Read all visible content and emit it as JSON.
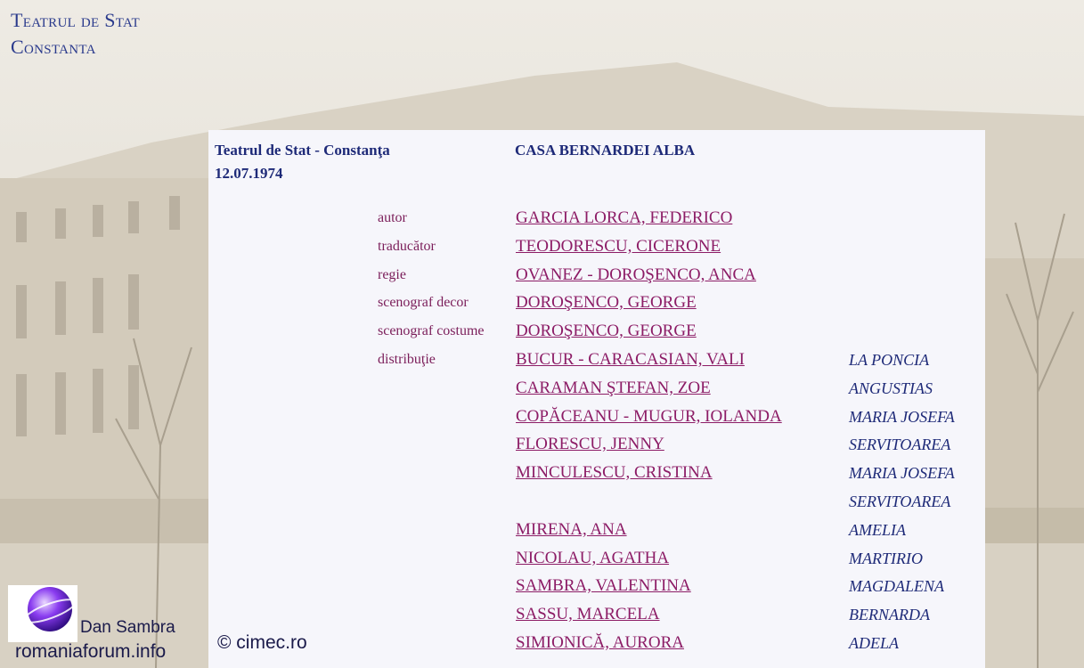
{
  "site_logo": {
    "line1": "Teatrul de Stat",
    "line2": "Constanta"
  },
  "header": {
    "theatre": "Teatrul de Stat - Constanţa",
    "date": "12.07.1974",
    "play_title": "CASA BERNARDEI ALBA"
  },
  "credits": [
    {
      "label": "autor",
      "name": "GARCIA LORCA, FEDERICO"
    },
    {
      "label": "traducător",
      "name": "TEODORESCU, CICERONE"
    },
    {
      "label": "regie",
      "name": "OVANEZ - DOROŞENCO, ANCA"
    },
    {
      "label": "scenograf decor",
      "name": "DOROŞENCO, GEORGE"
    },
    {
      "label": "scenograf costume",
      "name": "DOROŞENCO, GEORGE"
    }
  ],
  "cast_label": "distribuţie",
  "cast": [
    {
      "name": "BUCUR - CARACASIAN, VALI",
      "role": "LA PONCIA"
    },
    {
      "name": "CARAMAN ŞTEFAN, ZOE",
      "role": "ANGUSTIAS"
    },
    {
      "name": "COPĂCEANU - MUGUR, IOLANDA",
      "role": "MARIA JOSEFA"
    },
    {
      "name": "FLORESCU, JENNY",
      "role": "SERVITOAREA"
    },
    {
      "name": "MINCULESCU, CRISTINA",
      "role": "MARIA JOSEFA"
    },
    {
      "name": "",
      "role": "SERVITOAREA"
    },
    {
      "name": "MIRENA, ANA",
      "role": "AMELIA"
    },
    {
      "name": "NICOLAU, AGATHA",
      "role": "MARTIRIO"
    },
    {
      "name": "SAMBRA, VALENTINA",
      "role": "MAGDALENA"
    },
    {
      "name": "SASSU, MARCELA",
      "role": "BERNARDA"
    },
    {
      "name": "SIMIONICĂ, AURORA",
      "role": "ADELA"
    }
  ],
  "copyright": "© cimec.ro",
  "watermark": {
    "name": "Dan Sambra",
    "site": "romaniaforum.info"
  },
  "colors": {
    "label": "#7b1e5a",
    "link": "#8c1c66",
    "role": "#1e2a78",
    "header": "#1e2a78",
    "logo": "#2a3a8c"
  }
}
